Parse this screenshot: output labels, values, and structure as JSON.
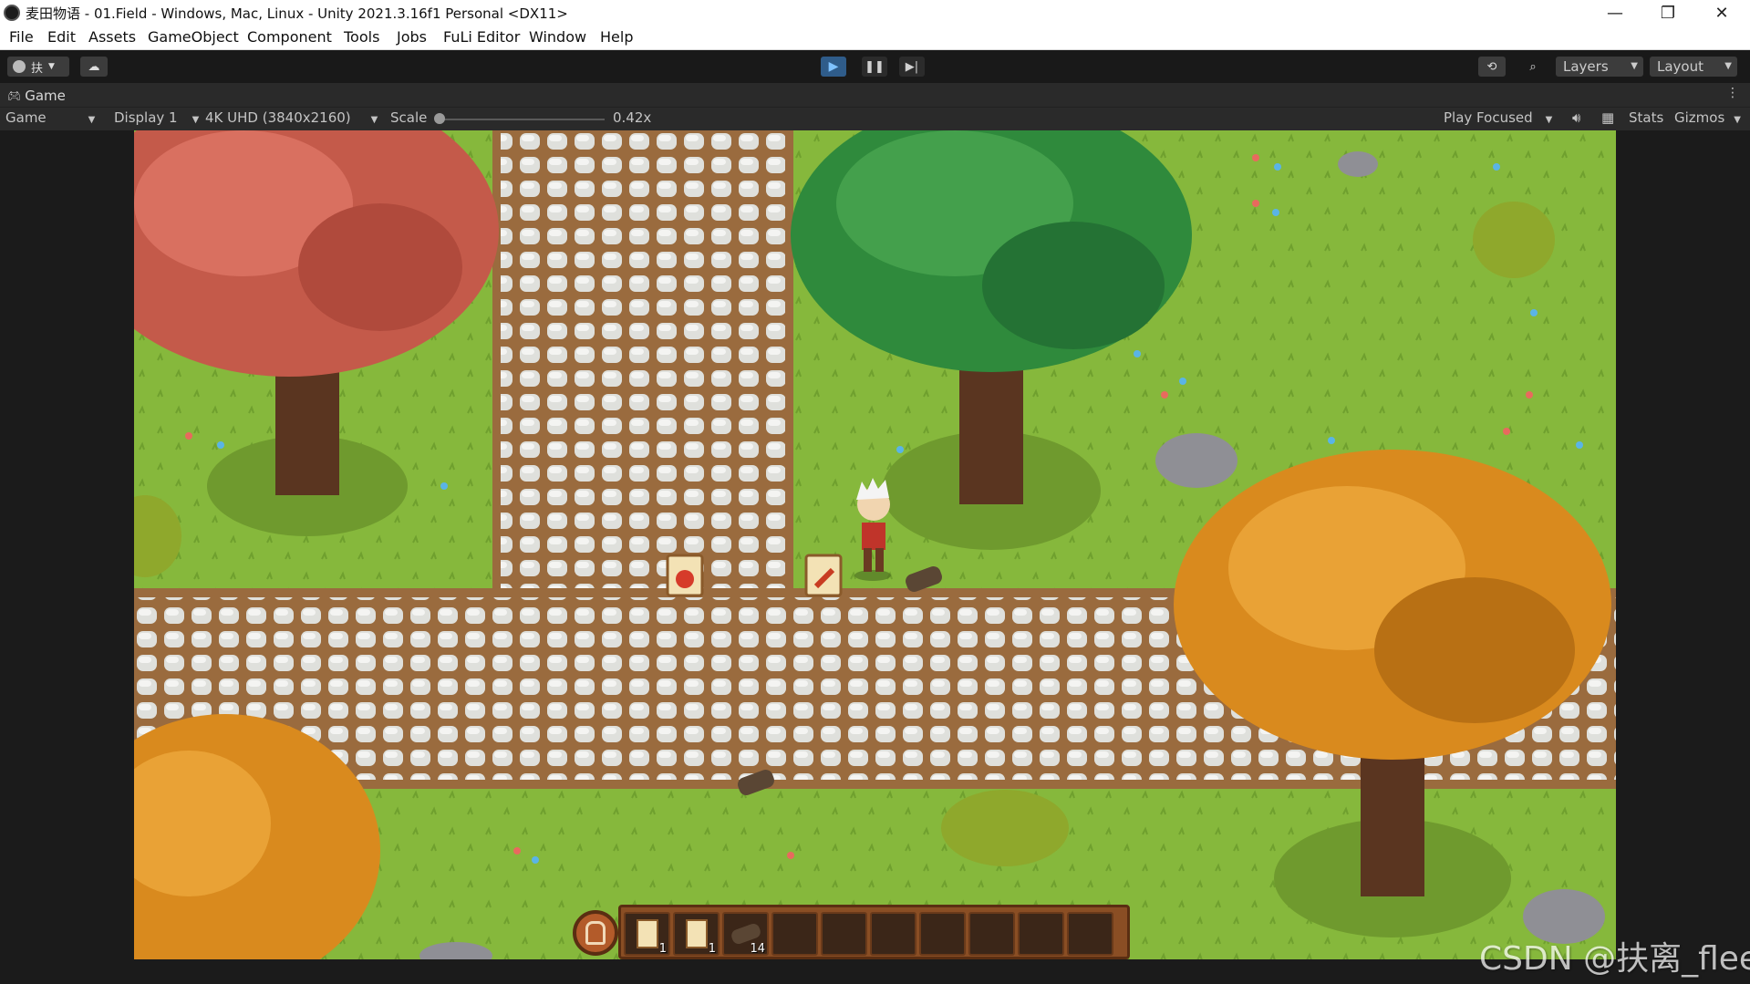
{
  "window": {
    "title": "麦田物语 - 01.Field - Windows, Mac, Linux - Unity 2021.3.16f1 Personal <DX11>",
    "controls": {
      "minimize": "—",
      "maximize": "❐",
      "close": "✕"
    }
  },
  "menu": [
    "File",
    "Edit",
    "Assets",
    "GameObject",
    "Component",
    "Tools",
    "Jobs",
    "FuLi Editor",
    "Window",
    "Help"
  ],
  "toolbar": {
    "account_label": "扶",
    "layers_label": "Layers",
    "layout_label": "Layout",
    "play_active": true
  },
  "game_tab": {
    "label": "Game"
  },
  "game_toolbar": {
    "view_mode": "Game",
    "display": "Display 1",
    "resolution": "4K UHD (3840x2160)",
    "scale_label": "Scale",
    "scale_value": "0.42x",
    "play_mode": "Play Focused",
    "stats_label": "Stats",
    "gizmos_label": "Gizmos"
  },
  "hotbar": {
    "slots": [
      {
        "icon": "seed-packet-icon",
        "count": "1"
      },
      {
        "icon": "tomato-packet-icon",
        "count": "1"
      },
      {
        "icon": "wood-log-icon",
        "count": "14"
      },
      {
        "icon": "",
        "count": ""
      },
      {
        "icon": "",
        "count": ""
      },
      {
        "icon": "",
        "count": ""
      },
      {
        "icon": "",
        "count": ""
      },
      {
        "icon": "",
        "count": ""
      },
      {
        "icon": "",
        "count": ""
      },
      {
        "icon": "",
        "count": ""
      }
    ]
  },
  "watermark": "CSDN @扶离_flee"
}
